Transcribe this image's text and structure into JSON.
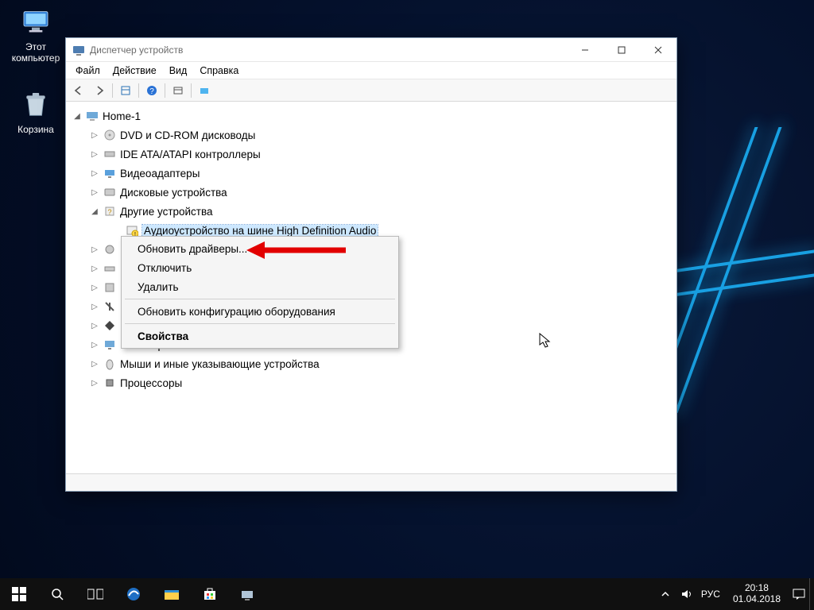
{
  "desktop": {
    "this_pc": "Этот компьютер",
    "recycle_bin": "Корзина"
  },
  "window": {
    "title": "Диспетчер устройств",
    "menu": {
      "file": "Файл",
      "action": "Действие",
      "view": "Вид",
      "help": "Справка"
    }
  },
  "tree": {
    "root": "Home-1",
    "cat_dvd": "DVD и CD-ROM дисководы",
    "cat_ide": "IDE ATA/ATAPI контроллеры",
    "cat_video": "Видеоадаптеры",
    "cat_disk": "Дисковые устройства",
    "cat_other": "Другие устройства",
    "item_hdaudio": "Аудиоустройство на шине High Definition Audio",
    "cat_sound": "",
    "cat_keyboard": "",
    "cat_computer": "",
    "cat_usb": "",
    "cat_system": "",
    "cat_monitor": "Мониторы",
    "cat_mouse": "Мыши и иные указывающие устройства",
    "cat_cpu": "Процессоры"
  },
  "context_menu": {
    "update": "Обновить драйверы...",
    "disable": "Отключить",
    "delete": "Удалить",
    "rescan": "Обновить конфигурацию оборудования",
    "properties": "Свойства"
  },
  "taskbar": {
    "lang": "РУС",
    "time": "20:18",
    "date": "01.04.2018"
  }
}
